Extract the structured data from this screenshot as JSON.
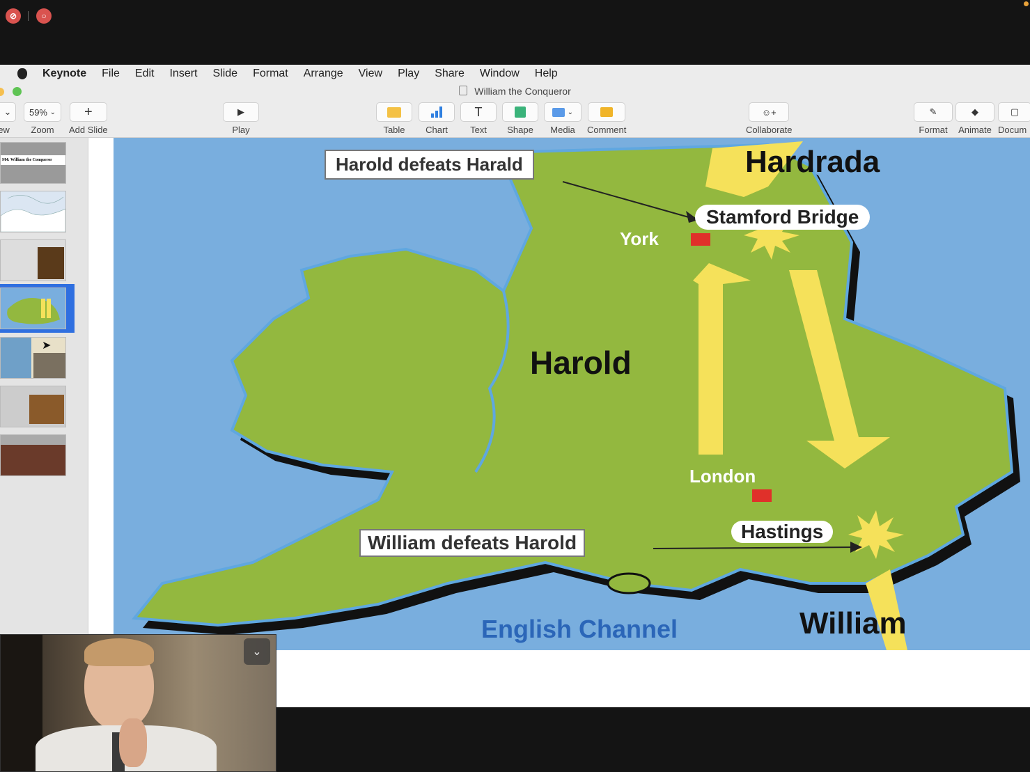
{
  "menubar": {
    "app": "Keynote",
    "items": [
      "File",
      "Edit",
      "Insert",
      "Slide",
      "Format",
      "Arrange",
      "View",
      "Play",
      "Share",
      "Window",
      "Help"
    ]
  },
  "window": {
    "title": "William the Conqueror"
  },
  "toolbar": {
    "view_label": "ew",
    "zoom_value": "59%",
    "zoom_label": "Zoom",
    "add_slide": "Add Slide",
    "play": "Play",
    "table": "Table",
    "chart": "Chart",
    "text": "Text",
    "shape": "Shape",
    "media": "Media",
    "comment": "Comment",
    "collaborate": "Collaborate",
    "format": "Format",
    "animate": "Animate",
    "document": "Docum"
  },
  "navigator": {
    "selected_index": 4,
    "thumbs": [
      {
        "caption": "M4: William the Conqueror"
      },
      {
        "caption": ""
      },
      {
        "caption": ""
      },
      {
        "caption": ""
      },
      {
        "caption": ""
      },
      {
        "caption": ""
      },
      {
        "caption": ""
      }
    ]
  },
  "slide": {
    "label_harold_harald": "Harold defeats Harald",
    "label_hardrada": "Hardrada",
    "label_stamford": "Stamford Bridge",
    "label_york": "York",
    "label_harold": "Harold",
    "label_london": "London",
    "label_hastings": "Hastings",
    "label_william_harold": "William defeats Harold",
    "label_channel": "English Channel",
    "label_william": "William"
  },
  "colors": {
    "sea": "#79aede",
    "land": "#93b83f",
    "arrow": "#f5e15a",
    "city": "#e0302a",
    "channel_text": "#2b66b8"
  }
}
